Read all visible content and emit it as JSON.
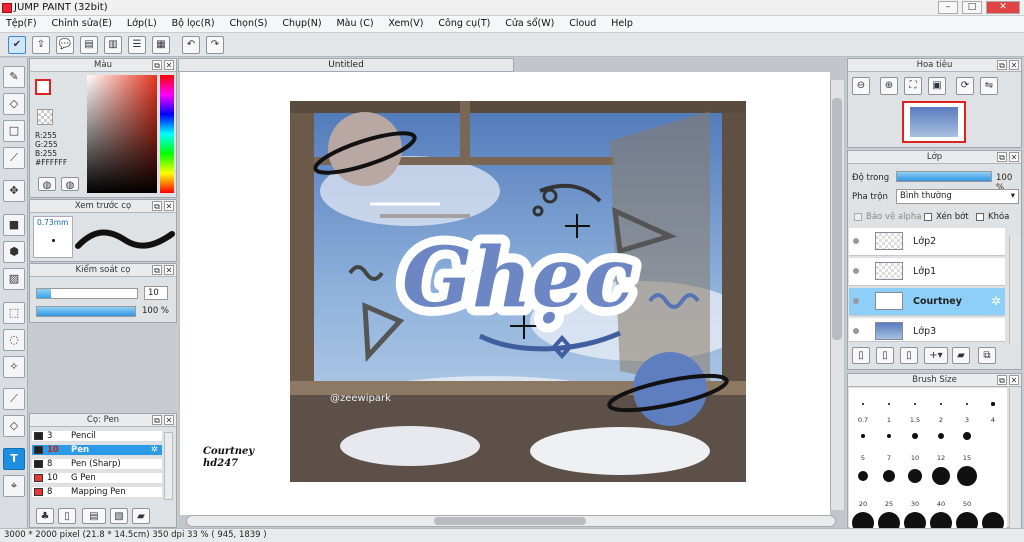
{
  "app": {
    "title": "JUMP PAINT (32bit)"
  },
  "menu": [
    "Tệp(F)",
    "Chỉnh sửa(E)",
    "Lớp(L)",
    "Bộ lọc(R)",
    "Chọn(S)",
    "Chụp(N)",
    "Màu (C)",
    "Xem(V)",
    "Công cụ(T)",
    "Cửa sổ(W)",
    "Cloud",
    "Help"
  ],
  "color_panel": {
    "title": "Màu",
    "r": "R:255",
    "g": "G:255",
    "b": "B:255",
    "hex": "#FFFFFF"
  },
  "preview_panel": {
    "title": "Xem trước cọ",
    "size": "0.73mm"
  },
  "control_panel": {
    "title": "Kiểm soát cọ",
    "size_value": "10",
    "opacity_value": "100 %"
  },
  "brush_panel": {
    "title": "Cọ: Pen",
    "items": [
      {
        "size": "3",
        "name": "Pencil",
        "color": "#222222"
      },
      {
        "size": "10",
        "name": "Pen",
        "color": "#222222"
      },
      {
        "size": "8",
        "name": "Pen (Sharp)",
        "color": "#222222"
      },
      {
        "size": "10",
        "name": "G Pen",
        "color": "#e53935"
      },
      {
        "size": "8",
        "name": "Mapping Pen",
        "color": "#e53935"
      }
    ]
  },
  "canvas": {
    "tab_title": "Untitled",
    "art_title": "Ghẹc",
    "watermark": "@zeewipark",
    "signature_line1": "Courtney",
    "signature_line2": "hd247"
  },
  "navigator": {
    "title": "Hoa tiêu"
  },
  "layers_panel": {
    "title": "Lớp",
    "opacity_label": "Độ trong",
    "opacity_value": "100 %",
    "blend_label": "Pha trộn",
    "blend_value": "Bình thường",
    "protect_alpha": "Bảo vệ alpha",
    "clip": "Xén bớt",
    "lock": "Khóa",
    "layers": [
      {
        "name": "Lớp2",
        "selected": false
      },
      {
        "name": "Lớp1",
        "selected": false
      },
      {
        "name": "Courtney",
        "selected": true
      },
      {
        "name": "Lớp3",
        "selected": false
      }
    ]
  },
  "brush_size_panel": {
    "title": "Brush Size",
    "labels": [
      "0.7",
      "1",
      "1.5",
      "2",
      "3",
      "4",
      "5",
      "7",
      "10",
      "12",
      "15",
      "20",
      "25",
      "30",
      "40",
      "50"
    ]
  },
  "status": {
    "text": "3000 * 2000 pixel   (21.8 * 14.5cm)   350 dpi   33 %   ( 945, 1839 )"
  }
}
